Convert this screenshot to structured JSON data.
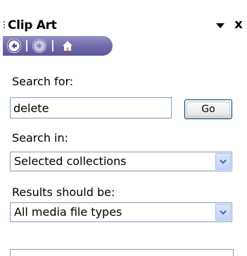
{
  "pane": {
    "title": "Clip Art",
    "menu_icon": "dropdown-arrow-icon",
    "close_label": "x"
  },
  "nav": {
    "back_icon": "back-arrow-icon",
    "forward_icon": "forward-arrow-icon",
    "home_icon": "home-icon"
  },
  "search": {
    "label": "Search for:",
    "value": "delete",
    "go_label": "Go"
  },
  "search_in": {
    "label": "Search in:",
    "selected": "Selected collections"
  },
  "results": {
    "label": "Results should be:",
    "selected": "All media file types"
  },
  "colors": {
    "nav_bar": "#6f69a8",
    "input_border": "#7f9db9",
    "button_border": "#003c74",
    "dropdown_button": "#c1d3fb"
  }
}
